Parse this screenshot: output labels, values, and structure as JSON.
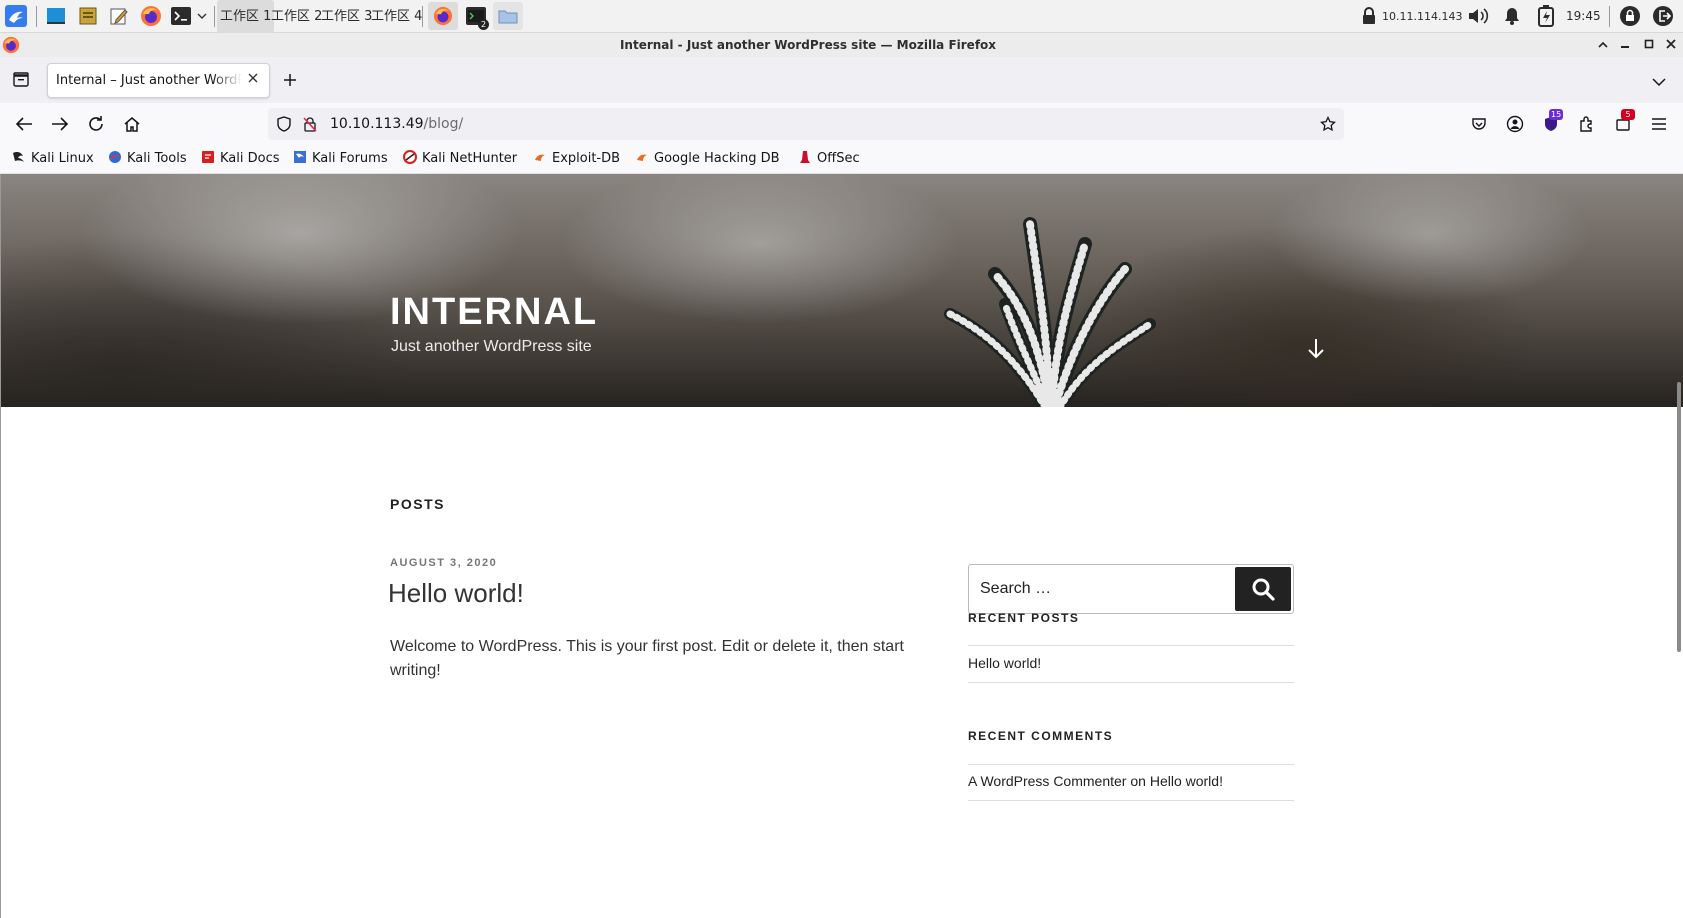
{
  "taskbar": {
    "workspaces": [
      "工作区 1",
      "工作区 2",
      "工作区 3",
      "工作区 4"
    ],
    "terminal_badge": "2",
    "ip_address": "10.11.114.143",
    "clock": "19:45"
  },
  "window": {
    "title": "Internal - Just another WordPress site — Mozilla Firefox"
  },
  "tabs": [
    {
      "label": "Internal – Just another WordPress site"
    }
  ],
  "navbar": {
    "url_host": "10.10.113.49",
    "url_path": "/blog/",
    "extension_badge_1": "15",
    "extension_badge_2": "5"
  },
  "bookmarks": [
    {
      "label": "Kali Linux",
      "icon": "kali-dragon-icon"
    },
    {
      "label": "Kali Tools",
      "icon": "kali-tools-icon"
    },
    {
      "label": "Kali Docs",
      "icon": "kali-docs-icon"
    },
    {
      "label": "Kali Forums",
      "icon": "kali-forums-icon"
    },
    {
      "label": "Kali NetHunter",
      "icon": "nethunter-icon"
    },
    {
      "label": "Exploit-DB",
      "icon": "exploit-db-icon"
    },
    {
      "label": "Google Hacking DB",
      "icon": "ghdb-icon"
    },
    {
      "label": "OffSec",
      "icon": "offsec-icon"
    }
  ],
  "site": {
    "title": "INTERNAL",
    "description": "Just another WordPress site"
  },
  "posts": {
    "heading": "POSTS",
    "items": [
      {
        "date": "AUGUST 3, 2020",
        "title": "Hello world!",
        "body": "Welcome to WordPress. This is your first post. Edit or delete it, then start writing!"
      }
    ]
  },
  "sidebar": {
    "search_placeholder": "Search …",
    "recent_posts_heading": "RECENT POSTS",
    "recent_posts": [
      "Hello world!"
    ],
    "recent_comments_heading": "RECENT COMMENTS",
    "recent_comment": {
      "author": "A WordPress Commenter",
      "on": "on",
      "post": "Hello world!"
    }
  },
  "colors": {
    "taskbar_bg": "#f2f2f2",
    "tab_strip_bg": "#f0f0f4",
    "search_button": "#222222",
    "badge_purple": "#6b2fd0",
    "badge_red": "#d70022"
  }
}
